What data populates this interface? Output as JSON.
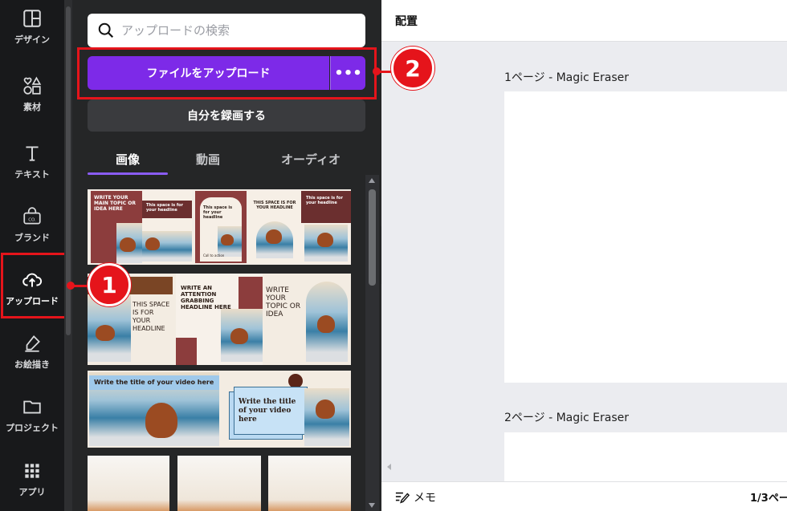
{
  "rail": {
    "items": [
      {
        "label": "デザイン",
        "icon": "layout-icon"
      },
      {
        "label": "素材",
        "icon": "elements-icon"
      },
      {
        "label": "テキスト",
        "icon": "text-icon"
      },
      {
        "label": "ブランド",
        "icon": "brand-icon"
      },
      {
        "label": "アップロード",
        "icon": "cloud-upload-icon"
      },
      {
        "label": "お絵描き",
        "icon": "draw-icon"
      },
      {
        "label": "プロジェクト",
        "icon": "folder-icon"
      },
      {
        "label": "アプリ",
        "icon": "apps-grid-icon"
      }
    ],
    "active_label": "アップロード"
  },
  "panel": {
    "search_placeholder": "アップロードの検索",
    "upload_label": "ファイルをアップロード",
    "more_label": "•••",
    "record_label": "自分を録画する",
    "tabs": [
      "画像",
      "動画",
      "オーディオ"
    ],
    "active_tab": "画像"
  },
  "thumbnails": {
    "row1": {
      "card1_text": "WRITE YOUR MAIN TOPIC OR IDEA HERE",
      "card2_text": "This space is for your headline",
      "card3_text": "This space is for your headline",
      "card3_small": "Call to action",
      "card4_text": "THIS SPACE IS FOR YOUR HEADLINE",
      "card5_text": "This space is for your headline"
    },
    "row2": {
      "card1_text": "THIS SPACE IS FOR YOUR HEADLINE",
      "card2_text": "WRITE AN ATTENTION GRABBING HEADLINE HERE",
      "card3_text": "WRITE YOUR TOPIC OR IDEA"
    },
    "row3": {
      "card1_text": "Write the title of your video here",
      "card2_text": "Write the title of your video here"
    }
  },
  "workspace": {
    "topbar_title": "配置",
    "pages": [
      {
        "label": "1ページ - Magic Eraser"
      },
      {
        "label": "2ページ - Magic Eraser"
      }
    ],
    "memo_label": "メモ",
    "page_count": "1/3ペー"
  },
  "callouts": [
    "1",
    "2"
  ],
  "colors": {
    "accent": "#7d2ae8",
    "highlight": "#e5141b",
    "rail_bg": "#18191b",
    "panel_bg": "#252627"
  }
}
